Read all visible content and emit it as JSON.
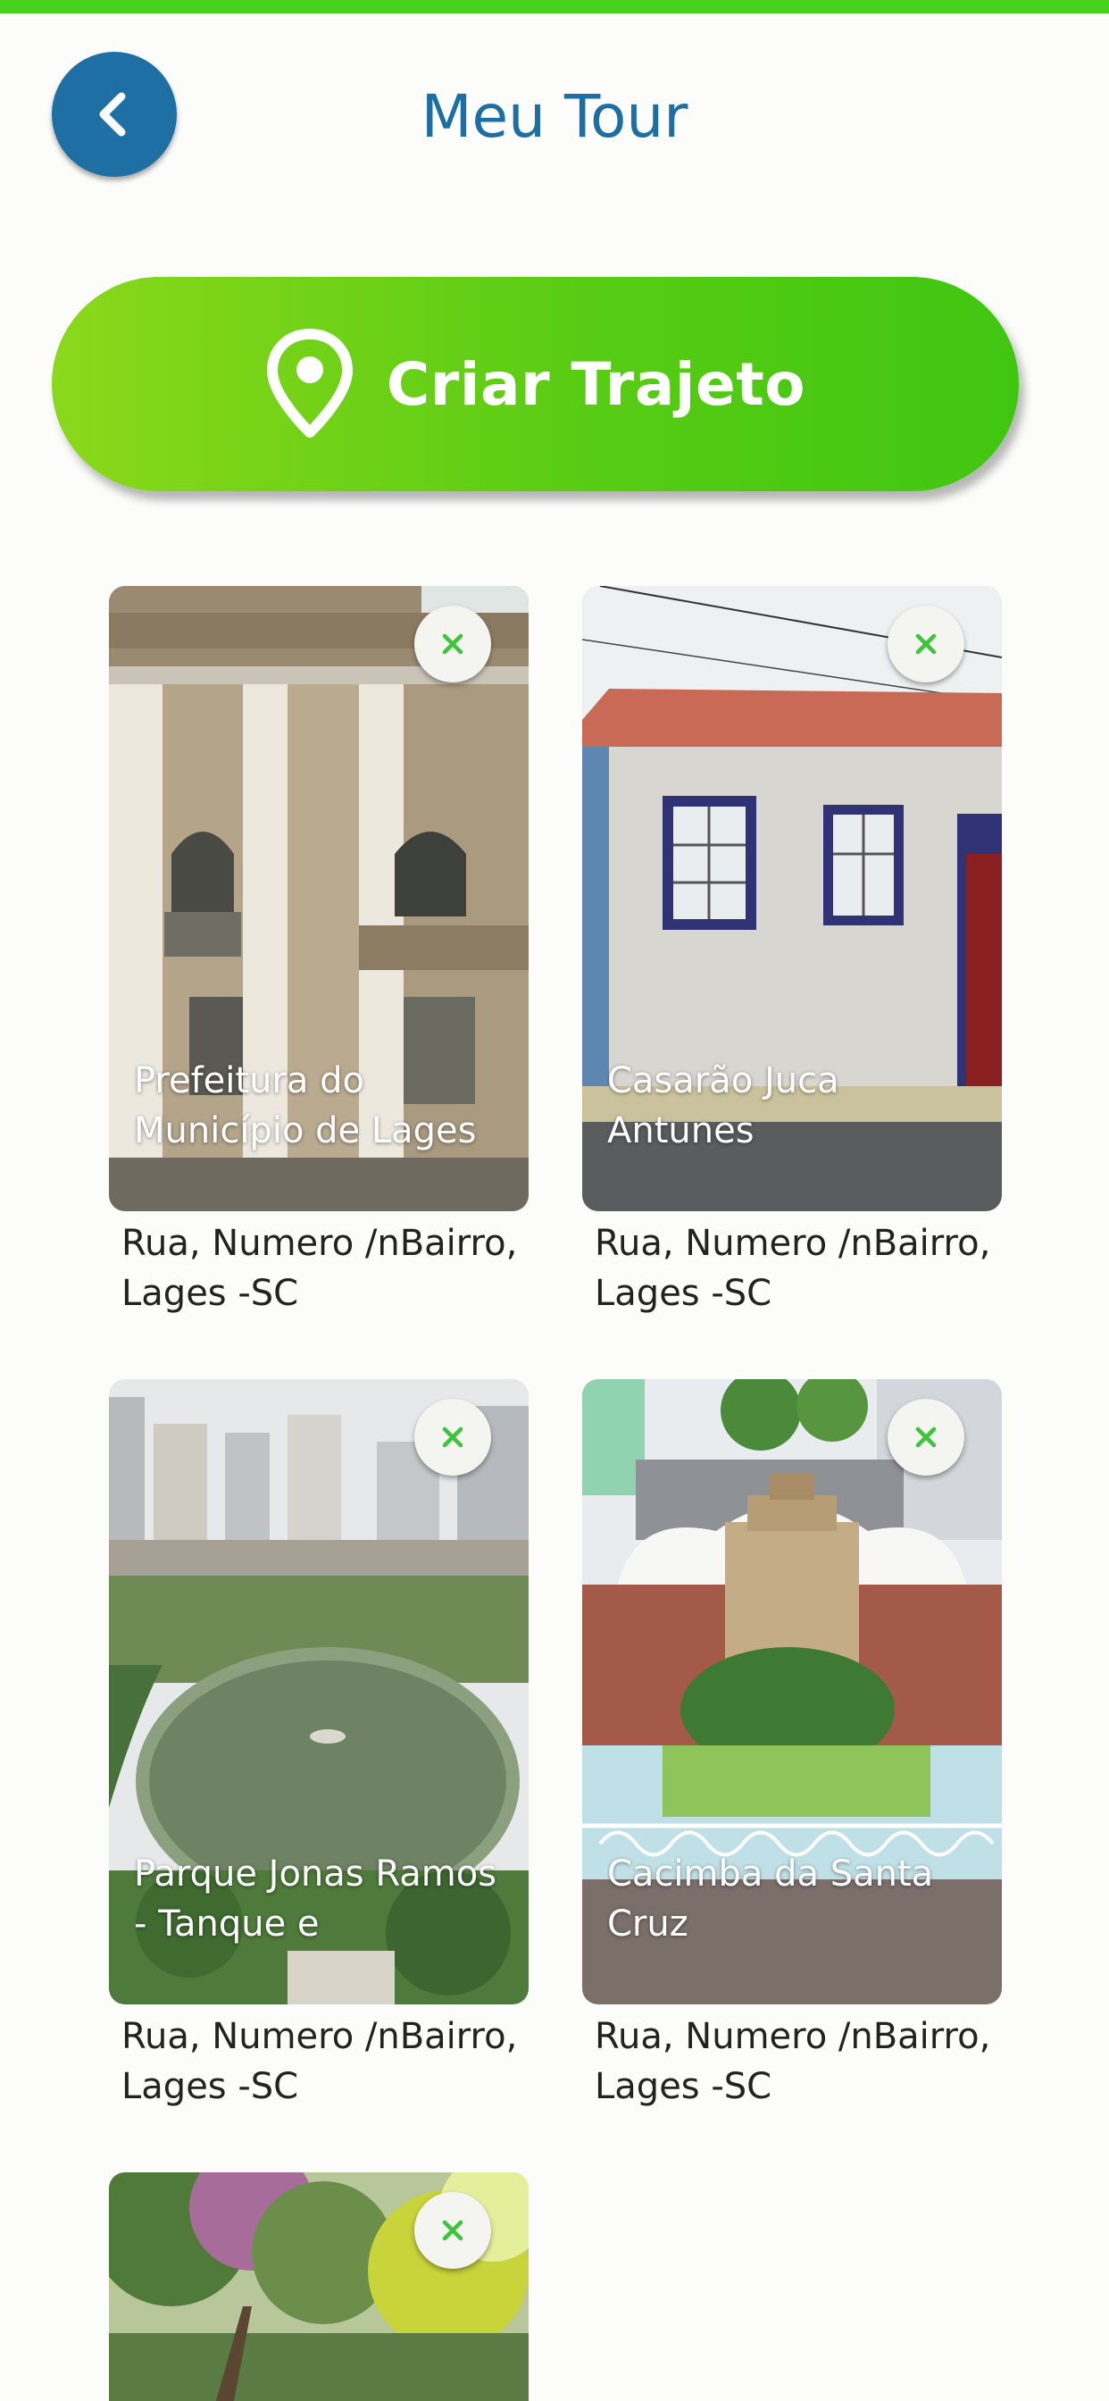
{
  "header": {
    "title": "Meu Tour"
  },
  "cta": {
    "label": "Criar Trajeto"
  },
  "colors": {
    "accent_green": "#47d11f",
    "brand_blue": "#1e6fa4",
    "remove_icon": "#3cc43a"
  },
  "icons": {
    "back": "chevron-left-icon",
    "cta": "map-pin-icon",
    "remove": "close-icon"
  },
  "places": [
    {
      "name": "Prefeitura do Município de Lages",
      "address": "Rua, Numero /nBairro, Lages -SC"
    },
    {
      "name": "Casarão Juca Antunes",
      "address": "Rua, Numero /nBairro, Lages -SC"
    },
    {
      "name": "Parque Jonas Ramos - Tanque e",
      "address": "Rua, Numero /nBairro, Lages -SC"
    },
    {
      "name": "Cacimba da Santa Cruz",
      "address": "Rua, Numero /nBairro, Lages -SC"
    },
    {
      "name": "",
      "address": ""
    }
  ]
}
